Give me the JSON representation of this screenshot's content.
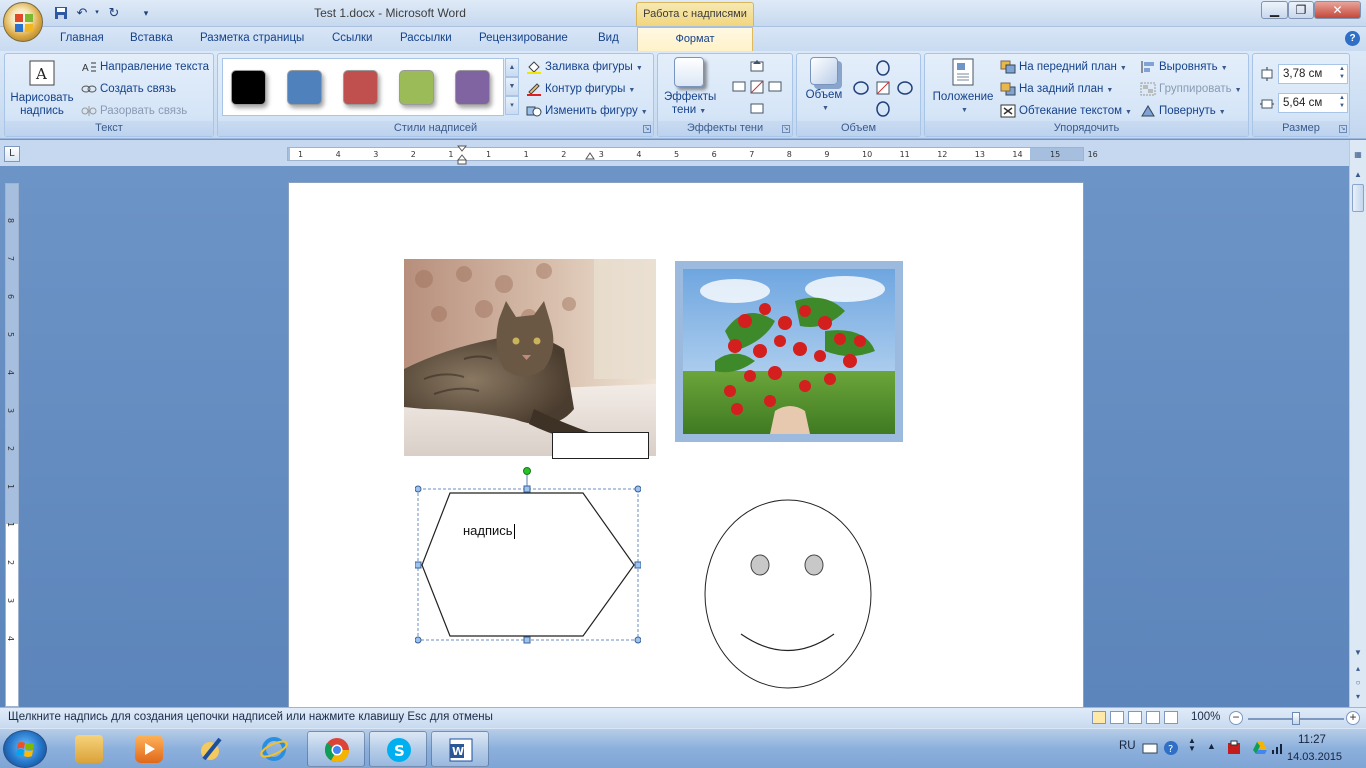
{
  "titlebar": {
    "document_title": "Test 1.docx - Microsoft Word",
    "context_tab_group": "Работа с надписями",
    "minimize": "▁",
    "maximize": "❐",
    "close": "✕"
  },
  "tabs": {
    "items": [
      "Главная",
      "Вставка",
      "Разметка страницы",
      "Ссылки",
      "Рассылки",
      "Рецензирование",
      "Вид"
    ],
    "active": "Формат"
  },
  "ribbon": {
    "text_group": {
      "label": "Текст",
      "draw_textbox": "Нарисовать надпись",
      "draw_textbox_line1": "Нарисовать",
      "draw_textbox_line2": "надпись",
      "text_direction": "Направление текста",
      "create_link": "Создать связь",
      "break_link": "Разорвать связь"
    },
    "styles_group": {
      "label": "Стили надписей",
      "swatches": [
        "#000000",
        "#4f81bd",
        "#c0504d",
        "#9bbb59",
        "#8064a2"
      ],
      "shape_fill": "Заливка фигуры",
      "shape_outline": "Контур фигуры",
      "change_shape": "Изменить фигуру"
    },
    "shadow_group": {
      "label": "Эффекты тени",
      "shadow_effects_line1": "Эффекты",
      "shadow_effects_line2": "тени"
    },
    "threed_group": {
      "label": "Объем",
      "volume": "Объем"
    },
    "arrange_group": {
      "label": "Упорядочить",
      "position": "Положение",
      "bring_front": "На передний план",
      "send_back": "На задний план",
      "text_wrap": "Обтекание текстом",
      "align": "Выровнять",
      "group": "Группировать",
      "rotate": "Повернуть"
    },
    "size_group": {
      "label": "Размер",
      "height": "3,78 см",
      "width": "5,64 см"
    }
  },
  "ruler": {
    "h_labels": [
      "1",
      "4",
      "3",
      "2",
      "1",
      "1",
      "1",
      "2",
      "3",
      "4",
      "5",
      "6",
      "7",
      "8",
      "9",
      "10",
      "11",
      "12",
      "13",
      "14",
      "15",
      "16"
    ],
    "v_labels": [
      "8",
      "7",
      "6",
      "5",
      "4",
      "3",
      "2",
      "1",
      "1",
      "2",
      "3",
      "4"
    ]
  },
  "document": {
    "textbox_text": "надпись"
  },
  "statusbar": {
    "message": "Щелкните надпись для создания цепочки надписей или нажмите клавишу Esc для отмены",
    "zoom": "100%",
    "zoom_fraction": 0.5
  },
  "taskbar": {
    "lang": "RU",
    "time": "11:27",
    "date": "14.03.2015"
  }
}
